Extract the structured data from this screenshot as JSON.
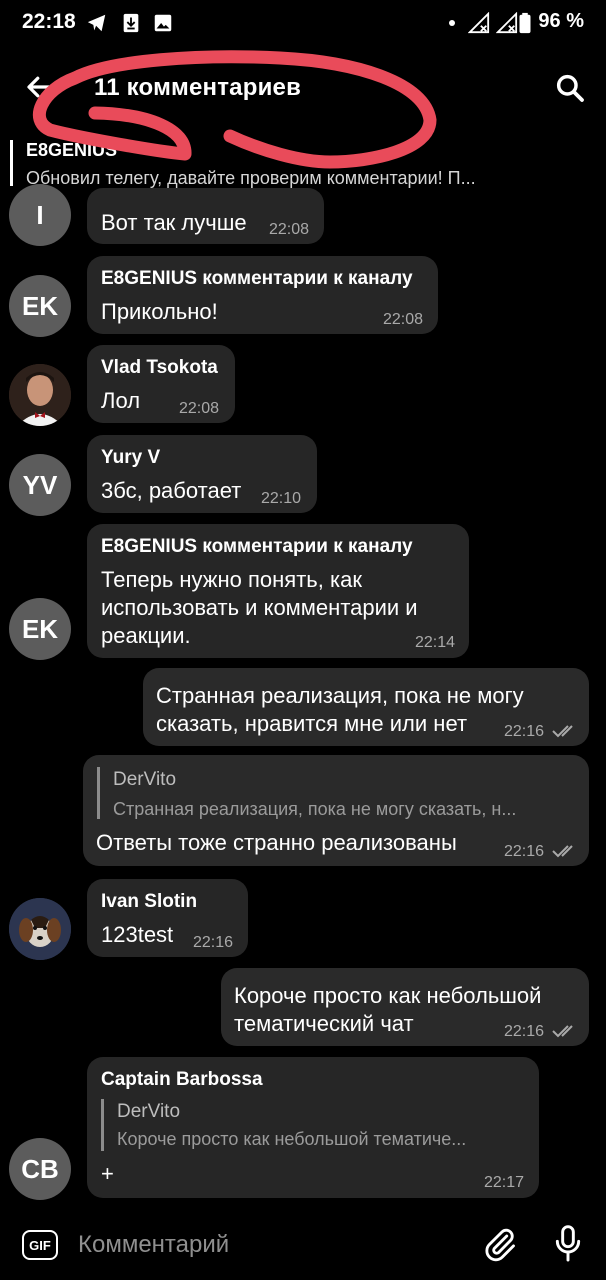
{
  "status_bar": {
    "time": "22:18",
    "battery": "96 %"
  },
  "header": {
    "title": "11 комментариев"
  },
  "pinned": {
    "name": "E8GENIUS",
    "text": "Обновил телегу, давайте проверим комментарии! П..."
  },
  "messages": [
    {
      "avatar": "I",
      "text": "Вот так лучше",
      "time": "22:08"
    },
    {
      "avatar": "EK",
      "sender": "E8GENIUS комментарии к каналу",
      "text": "Прикольно!",
      "time": "22:08"
    },
    {
      "sender": "Vlad Tsokota",
      "text": "Лол",
      "time": "22:08"
    },
    {
      "avatar": "YV",
      "sender": "Yury V",
      "text": "3бс, работает",
      "time": "22:10"
    },
    {
      "avatar": "EK",
      "sender": "E8GENIUS комментарии к каналу",
      "text_lines": [
        "Теперь нужно понять, как",
        "использовать и комментарии и",
        "реакции."
      ],
      "time": "22:14"
    },
    {
      "own": true,
      "text_lines": [
        "Странная реализация, пока не могу",
        "сказать, нравится мне или нет"
      ],
      "time": "22:16"
    },
    {
      "own": true,
      "quote_name": "DerVito",
      "quote_text": "Странная реализация, пока не могу сказать, н...",
      "text": "Ответы тоже странно реализованы",
      "time": "22:16"
    },
    {
      "sender": "Ivan Slotin",
      "text": "123test",
      "time": "22:16"
    },
    {
      "own": true,
      "text_lines": [
        "Короче просто как небольшой",
        "тематический чат"
      ],
      "time": "22:16"
    },
    {
      "avatar": "CB",
      "sender": "Captain Barbossa",
      "quote_name": "DerVito",
      "quote_text": "Короче просто как небольшой тематиче...",
      "text": "+",
      "time": "22:17"
    }
  ],
  "input": {
    "placeholder": "Комментарий",
    "gif_label": "GIF"
  },
  "colors": {
    "background": "#000000",
    "bubble": "#262626",
    "avatar": "#5c5c5c",
    "annotation": "#e94b5a"
  }
}
